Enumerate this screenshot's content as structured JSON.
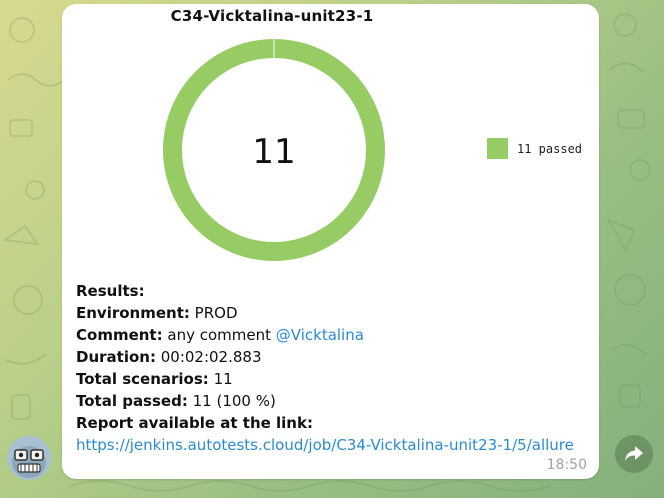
{
  "message": {
    "chart_data": {
      "type": "pie",
      "title": "C34-Vicktalina-unit23-1",
      "center_label": "11",
      "slices": [
        {
          "label": "passed",
          "value": 11,
          "color": "#97cc64"
        }
      ],
      "legend": [
        {
          "label": "11 passed",
          "color": "#97cc64"
        }
      ],
      "legend_position": "right"
    },
    "results_label": "Results:",
    "environment_label": "Environment:",
    "environment_value": "PROD",
    "comment_label": "Comment:",
    "comment_value": "any comment",
    "comment_mention": "@Vicktalina",
    "duration_label": "Duration:",
    "duration_value": "00:02:02.883",
    "total_scenarios_label": "Total scenarios:",
    "total_scenarios_value": "11",
    "total_passed_label": "Total passed:",
    "total_passed_value": "11 (100 %)",
    "report_label": "Report available at the link:",
    "report_link": "https://jenkins.autotests.cloud/job/C34-Vicktalina-unit23-1/5/allure",
    "time": "18:50"
  },
  "colors": {
    "passed": "#97cc64",
    "link": "#2a8bd4",
    "time": "#9aa6a2"
  },
  "icons": {
    "avatar": "bot-avatar-icon",
    "share": "share-arrow-icon"
  }
}
